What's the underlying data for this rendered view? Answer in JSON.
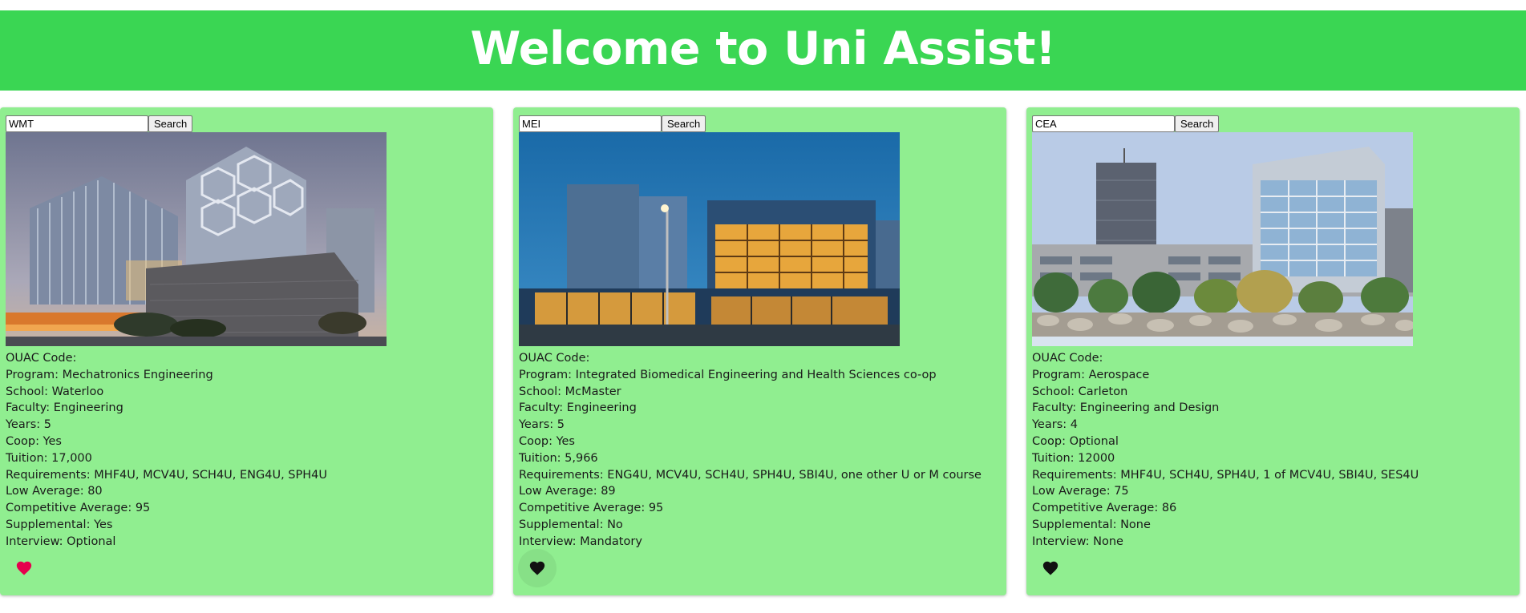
{
  "header": {
    "title": "Welcome to Uni Assist!"
  },
  "search": {
    "button_label": "Search"
  },
  "colors": {
    "banner": "#3ad653",
    "card": "#90ee90",
    "favorite_active": "#e5004d",
    "favorite_inactive": "#111111"
  },
  "cards": [
    {
      "query": "WMT",
      "image_icon": "campus-building-glass-hexagon-photo",
      "lines": [
        "OUAC Code:",
        "Program: Mechatronics Engineering",
        "School: Waterloo",
        "Faculty: Engineering",
        "Years: 5",
        "Coop: Yes",
        "Tuition: 17,000",
        "Requirements: MHF4U, MCV4U, SCH4U, ENG4U, SPH4U",
        "Low Average: 80",
        "Competitive Average: 95",
        "Supplemental: Yes",
        "Interview: Optional"
      ],
      "favorite": true
    },
    {
      "query": "MEI",
      "image_icon": "campus-building-night-glass-photo",
      "lines": [
        "OUAC Code:",
        "Program: Integrated Biomedical Engineering and Health Sciences co-op",
        "School: McMaster",
        "Faculty: Engineering",
        "Years: 5",
        "Coop: Yes",
        "Tuition: 5,966",
        "Requirements: ENG4U, MCV4U, SCH4U, SPH4U, SBI4U, one other U or M course",
        "Low Average: 89",
        "Competitive Average: 95",
        "Supplemental: No",
        "Interview: Mandatory"
      ],
      "favorite": false
    },
    {
      "query": "CEA",
      "image_icon": "campus-building-river-photo",
      "lines": [
        "OUAC Code:",
        "Program: Aerospace",
        "School: Carleton",
        "Faculty: Engineering and Design",
        "Years: 4",
        "Coop: Optional",
        "Tuition: 12000",
        "Requirements: MHF4U, SCH4U, SPH4U, 1 of MCV4U, SBI4U, SES4U",
        "Low Average: 75",
        "Competitive Average: 86",
        "Supplemental: None",
        "Interview: None"
      ],
      "favorite": false
    }
  ]
}
